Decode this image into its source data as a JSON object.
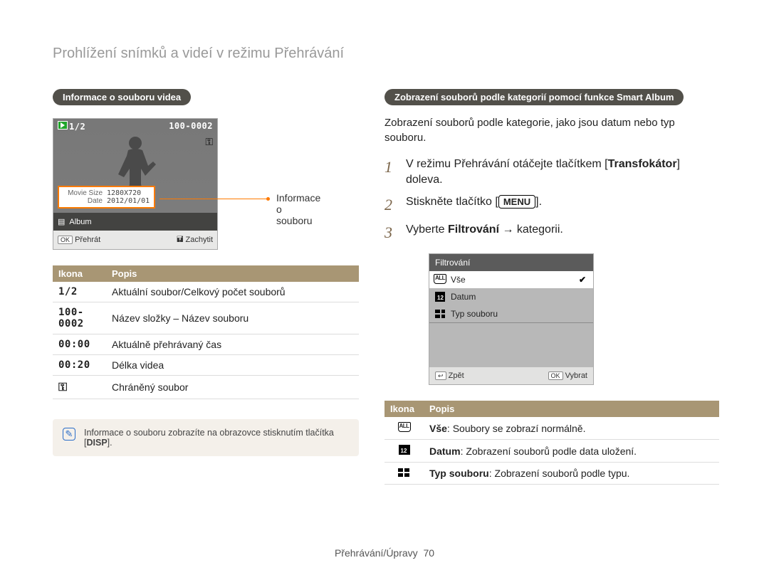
{
  "title": "Prohlížení snímků a videí v režimu Přehrávání",
  "footer": {
    "label": "Přehrávání/Úpravy",
    "page": "70"
  },
  "left": {
    "heading": "Informace o souboru videa",
    "video": {
      "counter": "1/2",
      "folder_file": "100-0002",
      "movie_size_label": "Movie Size",
      "movie_size": "1280X720",
      "date_label": "Date",
      "date": "2012/01/01",
      "album_row_icon": "▤",
      "album_row": "Album",
      "ok_button": "OK",
      "play_label": "Přehrát",
      "capture_icon": "🖬",
      "capture_label": "Zachytit"
    },
    "callout": "Informace o souboru",
    "table": {
      "h1": "Ikona",
      "h2": "Popis",
      "rows": [
        {
          "icon": "1/2",
          "desc": "Aktuální soubor/Celkový počet souborů"
        },
        {
          "icon": "100-0002",
          "desc": "Název složky – Název souboru"
        },
        {
          "icon": "00:00",
          "desc": "Aktuálně přehrávaný čas"
        },
        {
          "icon": "00:20",
          "desc": "Délka videa"
        },
        {
          "icon": "key",
          "desc": "Chráněný soubor"
        }
      ]
    },
    "note_pre": "Informace o souboru zobrazíte na obrazovce stisknutím tlačítka [",
    "note_btn": "DISP",
    "note_post": "]."
  },
  "right": {
    "heading": "Zobrazení souborů podle kategorií pomocí funkce Smart Album",
    "intro": "Zobrazení souborů podle kategorie, jako jsou datum nebo typ souboru.",
    "steps": {
      "s1a": "V režimu Přehrávání otáčejte tlačítkem [",
      "s1b": "Transfokátor",
      "s1c": "] doleva.",
      "s2a": "Stiskněte tlačítko [",
      "s2menu": "MENU",
      "s2b": "].",
      "s3a": "Vyberte ",
      "s3b": "Filtrování",
      "s3c": " → kategorii."
    },
    "menu": {
      "title": "Filtrování",
      "opt_all": "Vše",
      "opt_date": "Datum",
      "opt_type": "Typ souboru",
      "back_icon": "↩",
      "back": "Zpět",
      "ok_btn": "OK",
      "select": "Vybrat"
    },
    "table": {
      "h1": "Ikona",
      "h2": "Popis",
      "rows": [
        {
          "b": "Vše",
          "rest": ": Soubory se zobrazí normálně."
        },
        {
          "b": "Datum",
          "rest": ": Zobrazení souborů podle data uložení."
        },
        {
          "b": "Typ souboru",
          "rest": ": Zobrazení souborů podle typu."
        }
      ]
    }
  }
}
